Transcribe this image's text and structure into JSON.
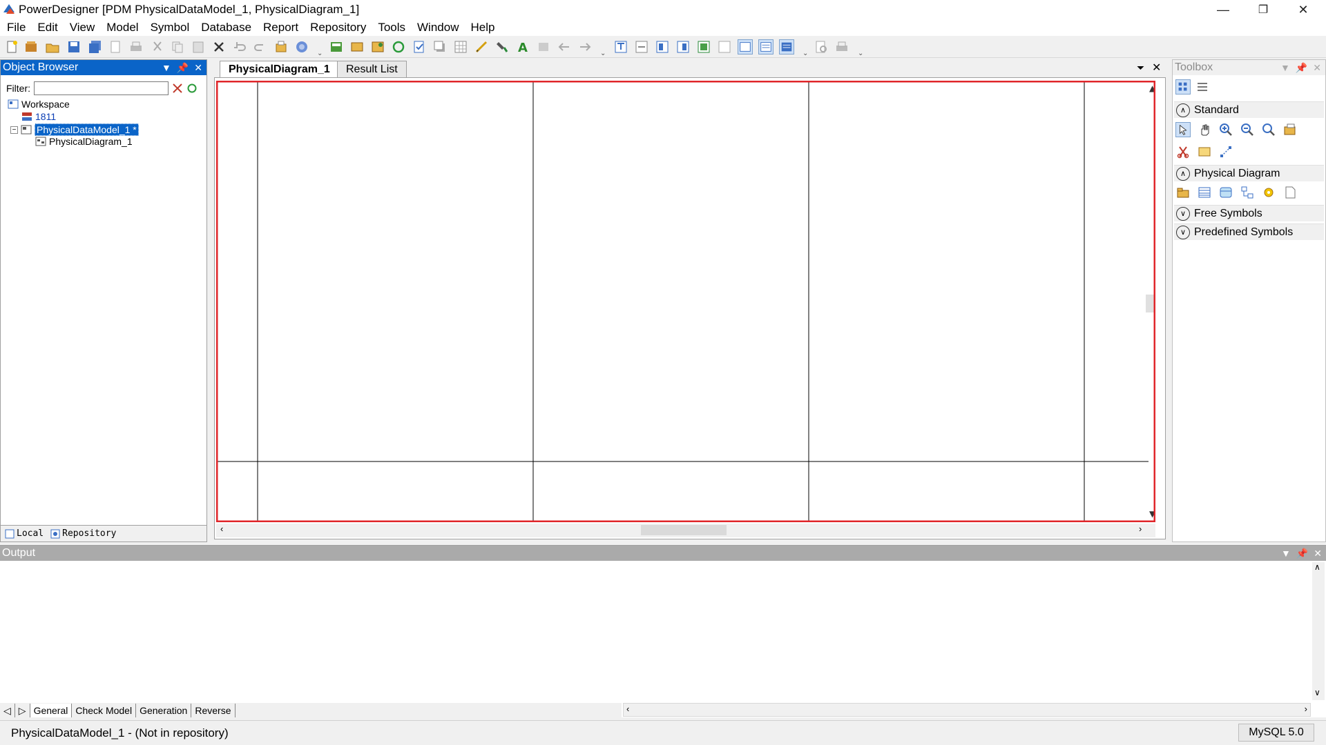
{
  "window": {
    "title": "PowerDesigner [PDM PhysicalDataModel_1, PhysicalDiagram_1]",
    "minimize": "—",
    "restore": "❐",
    "close": "✕"
  },
  "menu": [
    "File",
    "Edit",
    "View",
    "Model",
    "Symbol",
    "Database",
    "Report",
    "Repository",
    "Tools",
    "Window",
    "Help"
  ],
  "object_browser": {
    "title": "Object Browser",
    "filter_label": "Filter:",
    "filter_value": "",
    "tree": {
      "workspace": "Workspace",
      "item_1811": "1811",
      "model": "PhysicalDataModel_1 *",
      "diagram": "PhysicalDiagram_1"
    },
    "tabs": {
      "local": "Local",
      "repository": "Repository"
    }
  },
  "doc_tabs": {
    "active": "PhysicalDiagram_1",
    "other": "Result List"
  },
  "toolbox": {
    "title": "Toolbox",
    "sections": [
      "Standard",
      "Physical Diagram",
      "Free Symbols",
      "Predefined Symbols"
    ]
  },
  "output": {
    "title": "Output",
    "tabs": [
      "General",
      "Check Model",
      "Generation",
      "Reverse"
    ]
  },
  "status": {
    "text": "PhysicalDataModel_1 - (Not in repository)",
    "dbms": "MySQL 5.0"
  },
  "colors": {
    "selection_blue": "#0a64c8",
    "diagram_border_red": "#e0262a"
  }
}
